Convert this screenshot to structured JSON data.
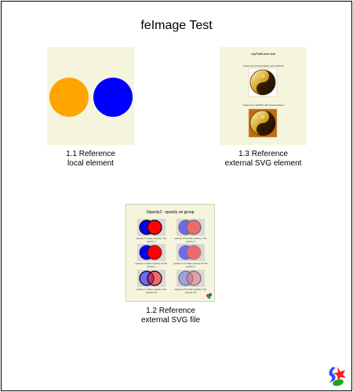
{
  "page": {
    "title": "feImage Test"
  },
  "examples": [
    {
      "id": "1.1",
      "caption_line1": "1.1 Reference",
      "caption_line2": "local element"
    },
    {
      "id": "1.3",
      "caption_line1": "1.3 Reference",
      "caption_line2": "external SVG element",
      "inner": {
        "title": "clipPathUsed test",
        "label_top": "Image from linearGradient with clipPath",
        "label_bottom": "Image from clipPath with linearGradient"
      }
    },
    {
      "id": "1.2",
      "caption_line1": "1.2 Reference",
      "caption_line2": "external SVG file",
      "inner": {
        "title": "Opacity2 : opacity on group",
        "rows": [
          {
            "left": "opacity 1 stroke-opacity 1 fill-opacity 1",
            "right": "opacity 0.5 stroke-opacity 1 fill-opacity 1"
          },
          {
            "left": "opacity 1 stroke-opacity 0.5 fill-opacity 1",
            "right": "opacity 0.5 stroke-opacity 0.5 fill-opacity 1"
          },
          {
            "left": "opacity 1 stroke-opacity 1 fill-opacity 0.5",
            "right": "opacity 0.5 stroke-opacity 1 fill-opacity 0.5"
          }
        ]
      }
    }
  ],
  "colors": {
    "panel_bg": "#f5f4dd",
    "orange": "#ffa500",
    "blue": "#0000ff",
    "red": "#ff0000"
  },
  "icons": {
    "logo": "svg-logo-icon"
  }
}
